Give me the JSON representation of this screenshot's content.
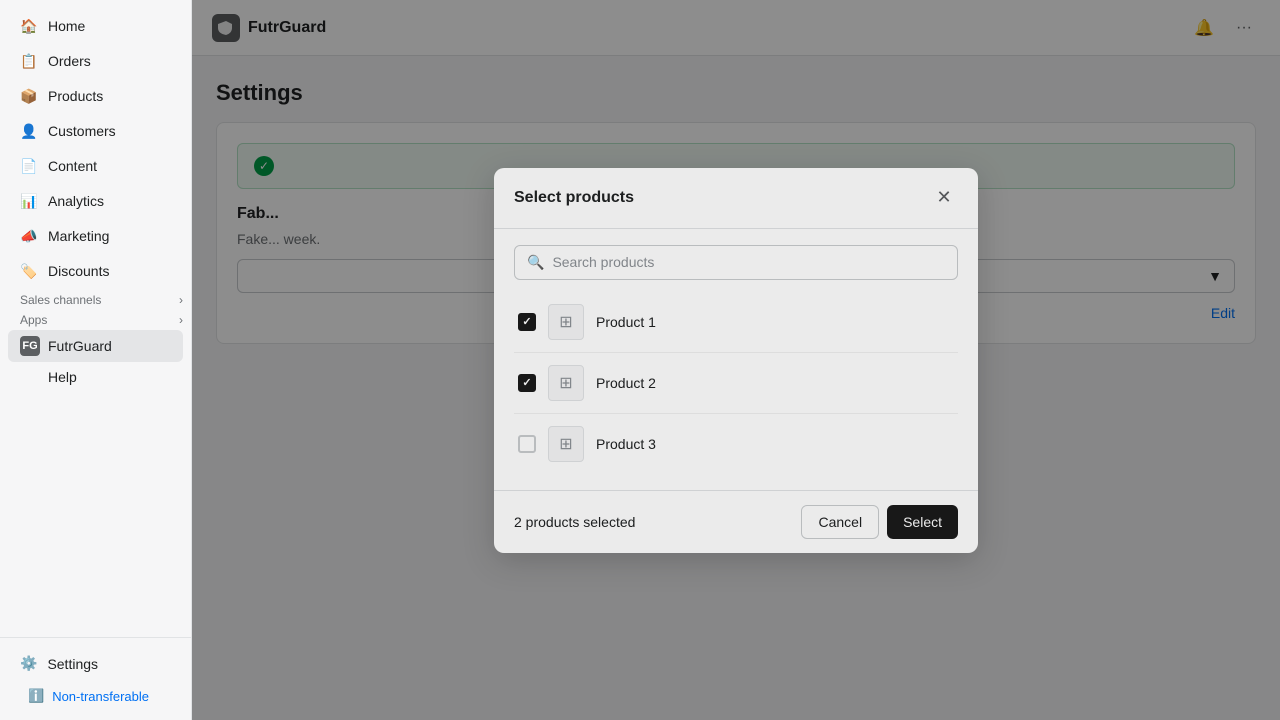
{
  "brand": {
    "name": "FutrGuard",
    "icon_label": "FG"
  },
  "sidebar": {
    "nav_items": [
      {
        "id": "home",
        "label": "Home",
        "icon": "🏠"
      },
      {
        "id": "orders",
        "label": "Orders",
        "icon": "📋"
      },
      {
        "id": "products",
        "label": "Products",
        "icon": "📦"
      },
      {
        "id": "customers",
        "label": "Customers",
        "icon": "👤"
      },
      {
        "id": "content",
        "label": "Content",
        "icon": "📄"
      },
      {
        "id": "analytics",
        "label": "Analytics",
        "icon": "📊"
      },
      {
        "id": "marketing",
        "label": "Marketing",
        "icon": "📣"
      },
      {
        "id": "discounts",
        "label": "Discounts",
        "icon": "🏷️"
      }
    ],
    "sales_channels_label": "Sales channels",
    "apps_label": "Apps",
    "app_name": "FutrGuard",
    "help_label": "Help",
    "settings_label": "Settings",
    "non_transferable_label": "Non-transferable"
  },
  "page": {
    "title": "Settings"
  },
  "modal": {
    "title": "Select products",
    "search_placeholder": "Search products",
    "products": [
      {
        "id": 1,
        "name": "Product 1",
        "checked": true
      },
      {
        "id": 2,
        "name": "Product 2",
        "checked": true
      },
      {
        "id": 3,
        "name": "Product 3",
        "checked": false
      }
    ],
    "selected_count_text": "2 products selected",
    "cancel_label": "Cancel",
    "select_label": "Select"
  },
  "topbar": {
    "notification_icon": "🔔",
    "more_icon": "···"
  }
}
